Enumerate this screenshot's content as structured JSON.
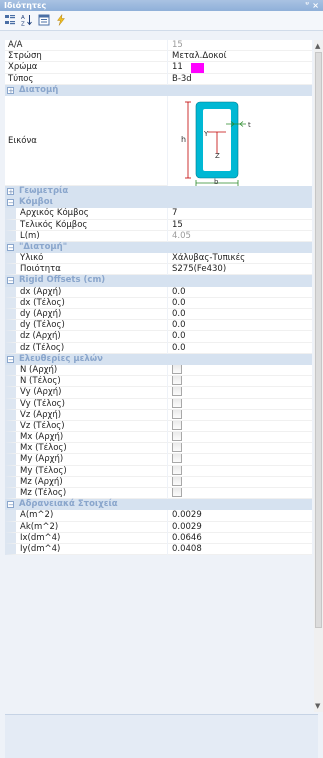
{
  "window": {
    "title": "Ιδιότητες",
    "pin_glyph": "ᵁ",
    "close_glyph": "×"
  },
  "toolbar": {
    "icons": [
      "categorized-icon",
      "sort-az-icon",
      "property-pages-icon",
      "events-icon"
    ]
  },
  "rows": [
    {
      "type": "row",
      "label": "A/A",
      "value": "15",
      "gray": true
    },
    {
      "type": "row",
      "label": "Στρώση",
      "value": "Μεταλ.Δοκοί"
    },
    {
      "type": "color",
      "label": "Χρώμα",
      "value": "11",
      "color": "#ff00ff"
    },
    {
      "type": "row",
      "label": "Τύπος",
      "value": "B-3d"
    },
    {
      "type": "cat",
      "label": "Διατομή",
      "expanded": false
    },
    {
      "type": "image",
      "label": "Εικόνα"
    },
    {
      "type": "cat",
      "label": "Γεωμετρία",
      "expanded": false
    },
    {
      "type": "cat",
      "label": "Κόμβοι",
      "expanded": true
    },
    {
      "type": "sub",
      "label": "Αρχικός Κόμβος",
      "value": "7"
    },
    {
      "type": "sub",
      "label": "Τελικός Κόμβος",
      "value": "15"
    },
    {
      "type": "sub",
      "label": "L(m)",
      "value": "4.05",
      "gray": true
    },
    {
      "type": "cat",
      "label": "\"Διατομή\"",
      "expanded": true
    },
    {
      "type": "sub",
      "label": "Υλικό",
      "value": "Χάλυβας-Τυπικές"
    },
    {
      "type": "sub",
      "label": "Ποιότητα",
      "value": "S275(Fe430)"
    },
    {
      "type": "cat",
      "label": "Rigid Offsets (cm)",
      "expanded": true
    },
    {
      "type": "sub",
      "label": "dx (Αρχή)",
      "value": "0.0"
    },
    {
      "type": "sub",
      "label": "dx (Τέλος)",
      "value": "0.0"
    },
    {
      "type": "sub",
      "label": "dy (Αρχή)",
      "value": "0.0"
    },
    {
      "type": "sub",
      "label": "dy (Τέλος)",
      "value": "0.0"
    },
    {
      "type": "sub",
      "label": "dz (Αρχή)",
      "value": "0.0"
    },
    {
      "type": "sub",
      "label": "dz (Τέλος)",
      "value": "0.0"
    },
    {
      "type": "cat",
      "label": "Ελευθερίες μελών",
      "expanded": true
    },
    {
      "type": "check",
      "label": "N (Αρχή)"
    },
    {
      "type": "check",
      "label": "N (Τέλος)"
    },
    {
      "type": "check",
      "label": "Vy (Αρχή)"
    },
    {
      "type": "check",
      "label": "Vy (Τέλος)"
    },
    {
      "type": "check",
      "label": "Vz (Αρχή)"
    },
    {
      "type": "check",
      "label": "Vz (Τέλος)"
    },
    {
      "type": "check",
      "label": "Mx (Αρχή)"
    },
    {
      "type": "check",
      "label": "Mx (Τέλος)"
    },
    {
      "type": "check",
      "label": "My (Αρχή)"
    },
    {
      "type": "check",
      "label": "My (Τέλος)"
    },
    {
      "type": "check",
      "label": "Mz (Αρχή)"
    },
    {
      "type": "check",
      "label": "Mz (Τέλος)"
    },
    {
      "type": "cat",
      "label": "Αδρανειακά Στοιχεία",
      "expanded": true
    },
    {
      "type": "sub",
      "label": "A(m^2)",
      "value": "0.0029"
    },
    {
      "type": "sub",
      "label": "Ak(m^2)",
      "value": "0.0029"
    },
    {
      "type": "sub",
      "label": "Ix(dm^4)",
      "value": "0.0646"
    },
    {
      "type": "sub",
      "label": "Iy(dm^4)",
      "value": "0.0408"
    }
  ],
  "section_image": {
    "labels": [
      "h",
      "Y",
      "Z",
      "t",
      "b"
    ]
  }
}
